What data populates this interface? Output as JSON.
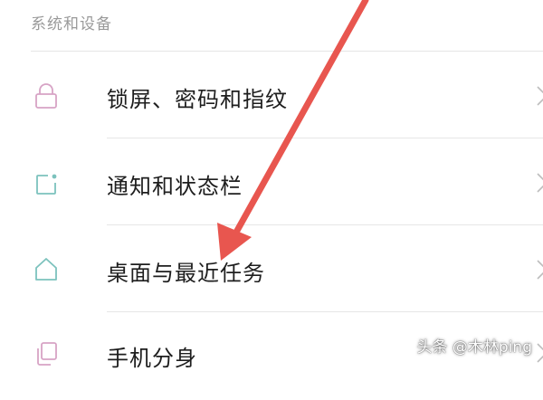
{
  "section": {
    "title": "系统和设备"
  },
  "items": [
    {
      "label": "锁屏、密码和指纹",
      "icon": "lock-icon"
    },
    {
      "label": "通知和状态栏",
      "icon": "notification-icon"
    },
    {
      "label": "桌面与最近任务",
      "icon": "home-icon"
    },
    {
      "label": "手机分身",
      "icon": "dual-space-icon"
    }
  ],
  "watermark": {
    "text": "头条 @木林ping"
  },
  "colors": {
    "lock_icon": "#d7a3c5",
    "teal_icon": "#7cc2bd",
    "arrow": "#e8564f",
    "chevron": "#bdbdbd"
  }
}
